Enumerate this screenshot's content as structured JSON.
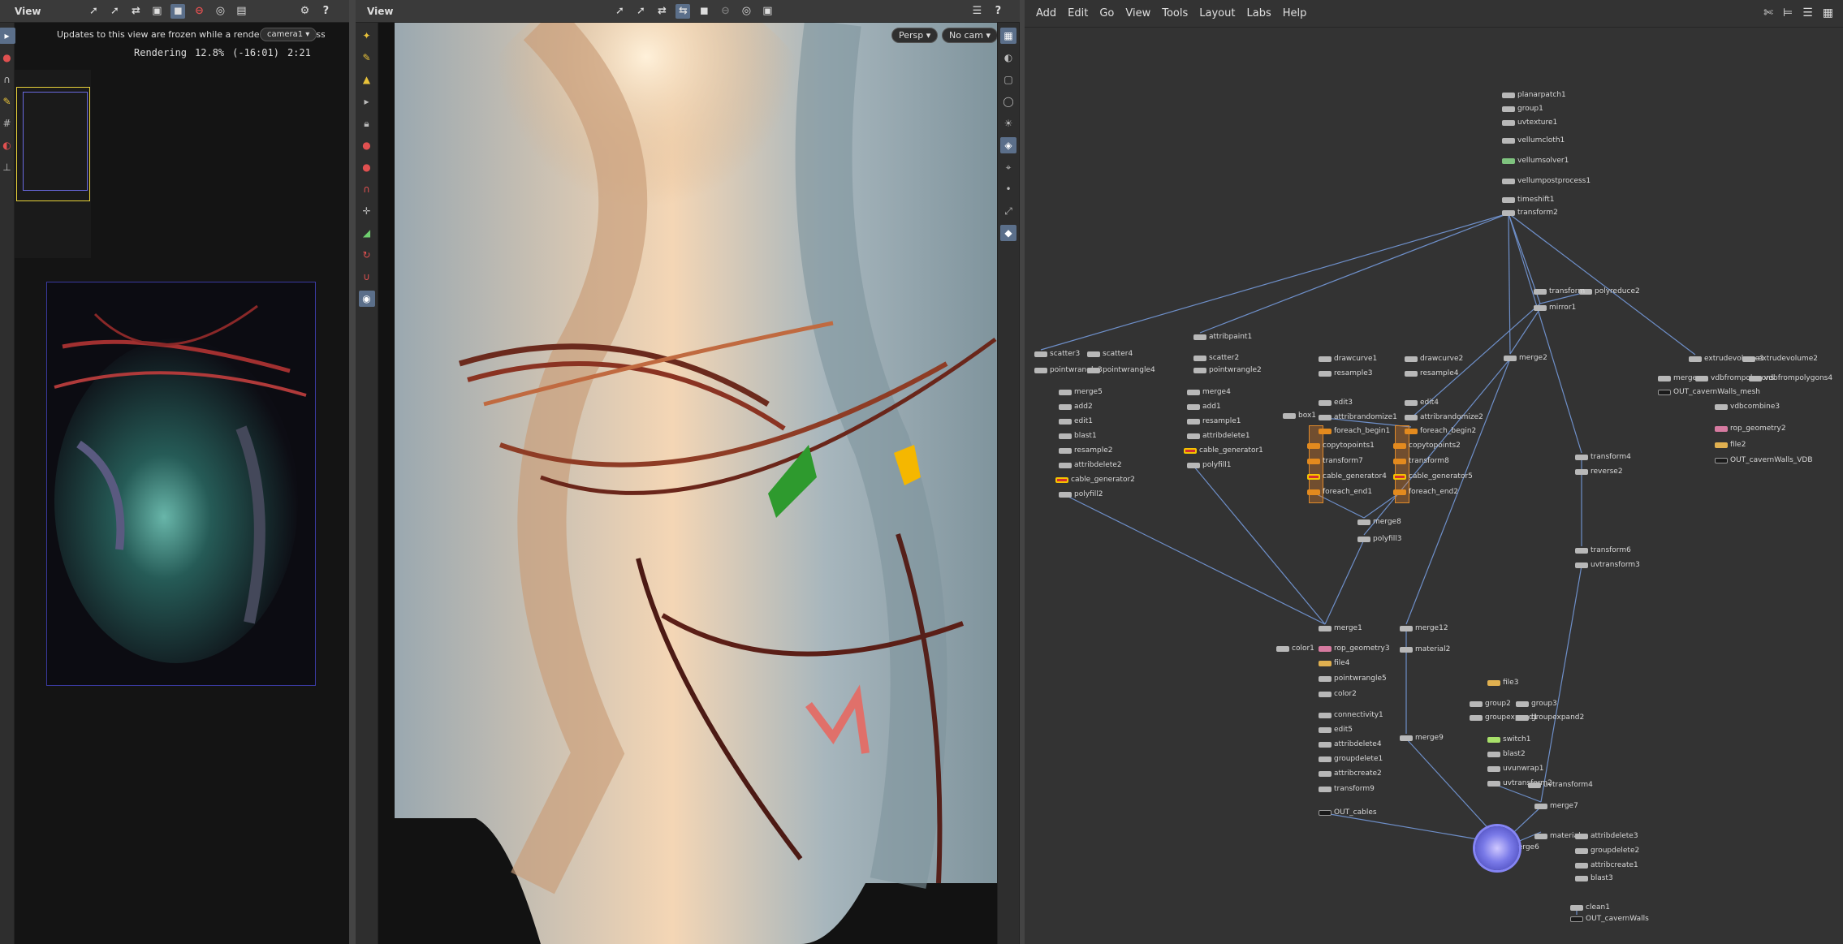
{
  "left_pane": {
    "title": "View",
    "notice": "Updates to this view are frozen while a render is in progress",
    "camera_pill": "camera1",
    "render_status": {
      "label": "Rendering",
      "percent": "12.8%",
      "elapsed": "(-16:01)",
      "remaining": "2:21"
    }
  },
  "mid_pane": {
    "title": "View",
    "persp_label": "Persp",
    "cam_label": "No cam"
  },
  "network": {
    "menu": [
      "Add",
      "Edit",
      "Go",
      "View",
      "Tools",
      "Layout",
      "Labs",
      "Help"
    ],
    "nodes": [
      {
        "label": "planarpatch1",
        "kind": "default"
      },
      {
        "label": "group1",
        "kind": "default"
      },
      {
        "label": "uvtexture1",
        "kind": "default"
      },
      {
        "label": "vellumcloth1",
        "kind": "default"
      },
      {
        "label": "vellumsolver1",
        "kind": "green"
      },
      {
        "label": "vellumpostprocess1",
        "kind": "default"
      },
      {
        "label": "timeshift1",
        "kind": "default"
      },
      {
        "label": "transform2",
        "kind": "default"
      },
      {
        "label": "polyreduce2",
        "kind": "default"
      },
      {
        "label": "transform",
        "kind": "default"
      },
      {
        "label": "mirror1",
        "kind": "default"
      },
      {
        "label": "merge2",
        "kind": "default"
      },
      {
        "label": "scatter3",
        "kind": "default"
      },
      {
        "label": "scatter4",
        "kind": "default"
      },
      {
        "label": "pointwrangle3",
        "kind": "default"
      },
      {
        "label": "pointwrangle4",
        "kind": "default"
      },
      {
        "label": "merge5",
        "kind": "default"
      },
      {
        "label": "add2",
        "kind": "default"
      },
      {
        "label": "edit1",
        "kind": "default"
      },
      {
        "label": "blast1",
        "kind": "default"
      },
      {
        "label": "resample2",
        "kind": "default"
      },
      {
        "label": "attribdelete2",
        "kind": "default"
      },
      {
        "label": "cable_generator2",
        "kind": "red"
      },
      {
        "label": "polyfill2",
        "kind": "default"
      },
      {
        "label": "attribpaint1",
        "kind": "default"
      },
      {
        "label": "scatter2",
        "kind": "default"
      },
      {
        "label": "pointwrangle2",
        "kind": "default"
      },
      {
        "label": "merge4",
        "kind": "default"
      },
      {
        "label": "add1",
        "kind": "default"
      },
      {
        "label": "resample1",
        "kind": "default"
      },
      {
        "label": "attribdelete1",
        "kind": "default"
      },
      {
        "label": "cable_generator1",
        "kind": "red"
      },
      {
        "label": "polyfill1",
        "kind": "default"
      },
      {
        "label": "drawcurve1",
        "kind": "default"
      },
      {
        "label": "resample3",
        "kind": "default"
      },
      {
        "label": "edit3",
        "kind": "default"
      },
      {
        "label": "attribrandomize1",
        "kind": "default"
      },
      {
        "label": "box1",
        "kind": "default"
      },
      {
        "label": "foreach_begin1",
        "kind": "orange"
      },
      {
        "label": "copytopoints1",
        "kind": "orange"
      },
      {
        "label": "transform7",
        "kind": "orange"
      },
      {
        "label": "cable_generator4",
        "kind": "red"
      },
      {
        "label": "foreach_end1",
        "kind": "orange"
      },
      {
        "label": "drawcurve2",
        "kind": "default"
      },
      {
        "label": "resample4",
        "kind": "default"
      },
      {
        "label": "edit4",
        "kind": "default"
      },
      {
        "label": "attribrandomize2",
        "kind": "default"
      },
      {
        "label": "foreach_begin2",
        "kind": "orange"
      },
      {
        "label": "copytopoints2",
        "kind": "orange"
      },
      {
        "label": "transform8",
        "kind": "orange"
      },
      {
        "label": "cable_generator5",
        "kind": "red"
      },
      {
        "label": "foreach_end2",
        "kind": "orange"
      },
      {
        "label": "merge8",
        "kind": "default"
      },
      {
        "label": "polyfill3",
        "kind": "default"
      },
      {
        "label": "extrudevolume1",
        "kind": "default"
      },
      {
        "label": "extrudevolume2",
        "kind": "default"
      },
      {
        "label": "merge",
        "kind": "default"
      },
      {
        "label": "vdbfrompolygons",
        "kind": "default"
      },
      {
        "label": "vdbfrompolygons4",
        "kind": "default"
      },
      {
        "label": "OUT_cavernWalls_mesh",
        "kind": "dark"
      },
      {
        "label": "vdbcombine3",
        "kind": "default"
      },
      {
        "label": "rop_geometry2",
        "kind": "pink"
      },
      {
        "label": "file2",
        "kind": "yellow"
      },
      {
        "label": "OUT_cavernWalls_VDB",
        "kind": "dark"
      },
      {
        "label": "transform4",
        "kind": "default"
      },
      {
        "label": "reverse2",
        "kind": "default"
      },
      {
        "label": "transform6",
        "kind": "default"
      },
      {
        "label": "uvtransform3",
        "kind": "default"
      },
      {
        "label": "merge1",
        "kind": "default"
      },
      {
        "label": "color1",
        "kind": "default"
      },
      {
        "label": "rop_geometry3",
        "kind": "pink"
      },
      {
        "label": "file4",
        "kind": "yellow"
      },
      {
        "label": "pointwrangle5",
        "kind": "default"
      },
      {
        "label": "color2",
        "kind": "default"
      },
      {
        "label": "connectivity1",
        "kind": "default"
      },
      {
        "label": "edit5",
        "kind": "default"
      },
      {
        "label": "attribdelete4",
        "kind": "default"
      },
      {
        "label": "groupdelete1",
        "kind": "default"
      },
      {
        "label": "attribcreate2",
        "kind": "default"
      },
      {
        "label": "transform9",
        "kind": "default"
      },
      {
        "label": "OUT_cables",
        "kind": "dark"
      },
      {
        "label": "merge12",
        "kind": "default"
      },
      {
        "label": "material2",
        "kind": "default"
      },
      {
        "label": "merge9",
        "kind": "default"
      },
      {
        "label": "file3",
        "kind": "yellow"
      },
      {
        "label": "group2",
        "kind": "default"
      },
      {
        "label": "group3",
        "kind": "default"
      },
      {
        "label": "groupexpand1",
        "kind": "default"
      },
      {
        "label": "groupexpand2",
        "kind": "default"
      },
      {
        "label": "switch1",
        "kind": "lime"
      },
      {
        "label": "blast2",
        "kind": "default"
      },
      {
        "label": "uvunwrap1",
        "kind": "default"
      },
      {
        "label": "uvtransform2",
        "kind": "default"
      },
      {
        "label": "uvtransform4",
        "kind": "default"
      },
      {
        "label": "merge7",
        "kind": "default"
      },
      {
        "label": "merge6",
        "kind": "default"
      },
      {
        "label": "material",
        "kind": "default"
      },
      {
        "label": "attribdelete3",
        "kind": "default"
      },
      {
        "label": "groupdelete2",
        "kind": "default"
      },
      {
        "label": "attribcreate1",
        "kind": "default"
      },
      {
        "label": "blast3",
        "kind": "default"
      },
      {
        "label": "clean1",
        "kind": "default"
      },
      {
        "label": "OUT_cavernWalls",
        "kind": "dark"
      }
    ]
  },
  "colors": {
    "accent": "#5b6f8a",
    "selected_node_ring": "#6a6ae0",
    "foreach_group": "#e08a2a",
    "wire": "#6e8fc9"
  }
}
